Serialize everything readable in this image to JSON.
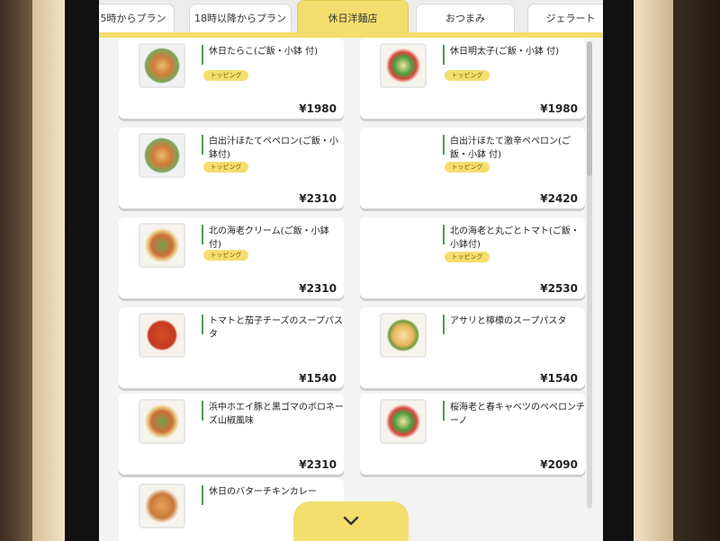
{
  "tabs": [
    {
      "label": "5時からプラン"
    },
    {
      "label": "18時以降からプラン"
    },
    {
      "label": "休日洋麺店"
    },
    {
      "label": "おつまみ"
    },
    {
      "label": "ジェラート"
    }
  ],
  "menu": {
    "items": [
      {
        "name": "休日たらこ(ご飯・小鉢 付)",
        "badge": "トッピング",
        "price": "¥1980",
        "icon": "pasta-dish"
      },
      {
        "name": "休日明太子(ご飯・小鉢 付)",
        "badge": "トッピング",
        "price": "¥1980",
        "icon": "salad-dish"
      },
      {
        "name": "白出汁ほたてペペロン(ご飯・小鉢付)",
        "badge": "トッピング",
        "price": "¥2310",
        "icon": "pasta-dish"
      },
      {
        "name": "白出汁ほたて激辛ペペロン(ご飯・小鉢 付)",
        "badge": "トッピング",
        "price": "¥2420",
        "icon": "none"
      },
      {
        "name": "北の海老クリーム(ご飯・小鉢 付)",
        "badge": "トッピング",
        "price": "¥2310",
        "icon": "pasta-dish"
      },
      {
        "name": "北の海老と丸ごとトマト(ご飯・小鉢付)",
        "badge": "トッピング",
        "price": "¥2530",
        "icon": "none"
      },
      {
        "name": "トマトと茄子チーズのスープパスタ",
        "badge": "",
        "price": "¥1540",
        "icon": "tomato-soup-dish"
      },
      {
        "name": "アサリと檸檬のスープパスタ",
        "badge": "",
        "price": "¥1540",
        "icon": "clam-soup-dish"
      },
      {
        "name": "浜中ホエイ豚と黒ゴマのボロネーズ山椒風味",
        "badge": "",
        "price": "¥2310",
        "icon": "bolognese-dish"
      },
      {
        "name": "桜海老と春キャベツのペペロンチーノ",
        "badge": "",
        "price": "¥2090",
        "icon": "peperoncino-dish"
      },
      {
        "name": "休日のバターチキンカレー",
        "badge": "",
        "price": "",
        "icon": "curry-dish"
      }
    ]
  },
  "scroll_down": {
    "icon": "chevron-down-icon"
  },
  "colors": {
    "accent": "#f4df6e",
    "divider": "#4d9a56"
  }
}
